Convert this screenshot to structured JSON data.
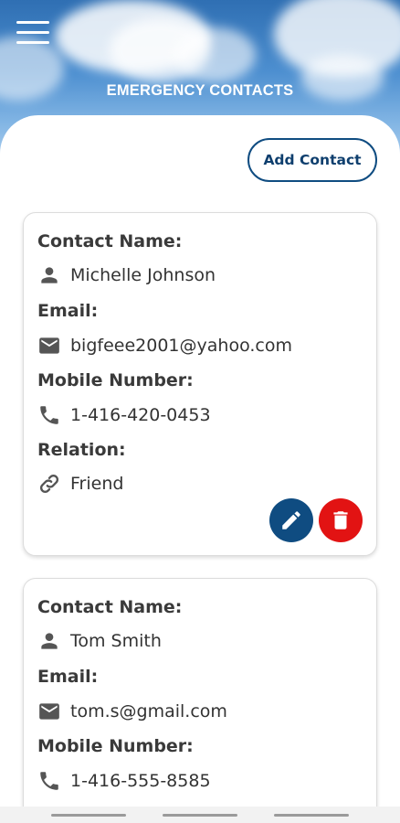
{
  "header": {
    "title": "EMERGENCY CONTACTS",
    "menu_icon": "hamburger-menu-icon"
  },
  "toolbar": {
    "add_contact_label": "Add Contact"
  },
  "labels": {
    "contact_name": "Contact Name:",
    "email": "Email:",
    "mobile_number": "Mobile Number:",
    "relation": "Relation:"
  },
  "contacts": [
    {
      "name": "Michelle Johnson",
      "email": "bigfeee2001@yahoo.com",
      "mobile": "1-416-420-0453",
      "relation": "Friend"
    },
    {
      "name": "Tom Smith",
      "email": "tom.s@gmail.com",
      "mobile": "1-416-555-8585"
    }
  ],
  "colors": {
    "accent": "#0f4c81",
    "delete": "#e21313",
    "label_text": "#3a3a3a",
    "icon": "#555555"
  },
  "icons": {
    "person": "person-icon",
    "email": "email-icon",
    "phone": "phone-icon",
    "relation": "link-icon",
    "edit": "pencil-icon",
    "delete": "trash-icon"
  }
}
